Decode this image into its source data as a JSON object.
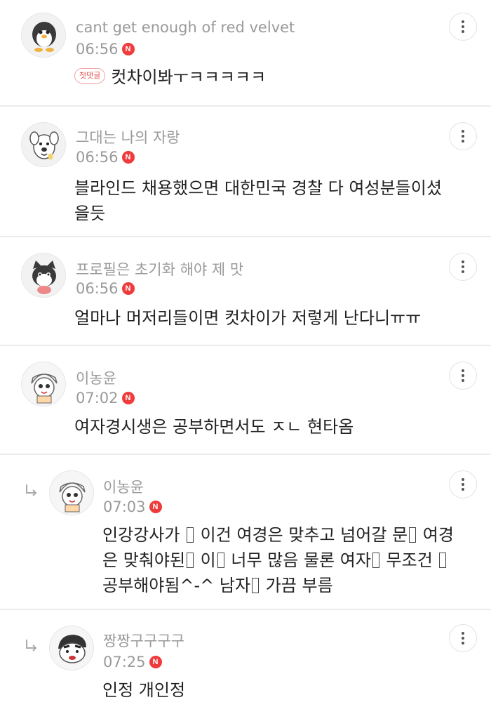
{
  "comments": [
    {
      "nick": "cant get enough of red velvet",
      "time": "06:56",
      "first_badge": "첫댓글",
      "text_lines": [
        "컷차이봐ㅜㅋㅋㅋㅋㅋ"
      ],
      "avatar_icon": "penguin-avatar-icon",
      "is_reply": false
    },
    {
      "nick": "그대는 나의 자랑",
      "time": "06:56",
      "text_lines": [
        "블라인드 채용했으면 대한민국 경찰 다 여성분들이셨",
        "을듯"
      ],
      "avatar_icon": "dog-avatar-icon",
      "is_reply": false
    },
    {
      "nick": "프로필은 초기화 해야 제 맛",
      "time": "06:56",
      "text_lines": [
        "얼마나 머저리들이면 컷차이가 저렇게 난다니ㅠㅠ"
      ],
      "avatar_icon": "cat-avatar-icon",
      "is_reply": false
    },
    {
      "nick": "이농윤",
      "time": "07:02",
      "text_lines": [
        "여자경시생은 공부하면서도 ㅈㄴ 현타옴"
      ],
      "avatar_icon": "cartoon-avatar-icon",
      "is_reply": false
    },
    {
      "nick": "이농윤",
      "time": "07:03",
      "text_lines": [
        "인강강사가 ",
        " 이건 여경은 맞추고 넘어갈 문",
        " 여경",
        "은 맞춰야된",
        " 이",
        " 너무 많음 물론 여자",
        " 무조건 ",
        "공부해야됨^-^ 남자",
        " 가끔 부름"
      ],
      "avatar_icon": "cartoon-avatar-icon",
      "is_reply": true
    },
    {
      "nick": "짱짱구구구구",
      "time": "07:25",
      "text_lines": [
        "인정 개인정"
      ],
      "avatar_icon": "shinchan-avatar-icon",
      "is_reply": true
    }
  ],
  "new_badge": "N",
  "colors": {
    "accent_red": "#ef3b3b",
    "meta_gray": "#9a9a9a",
    "divider": "#ececec"
  },
  "icons": {
    "more": "more-vertical-icon",
    "reply": "reply-arrow-icon"
  }
}
